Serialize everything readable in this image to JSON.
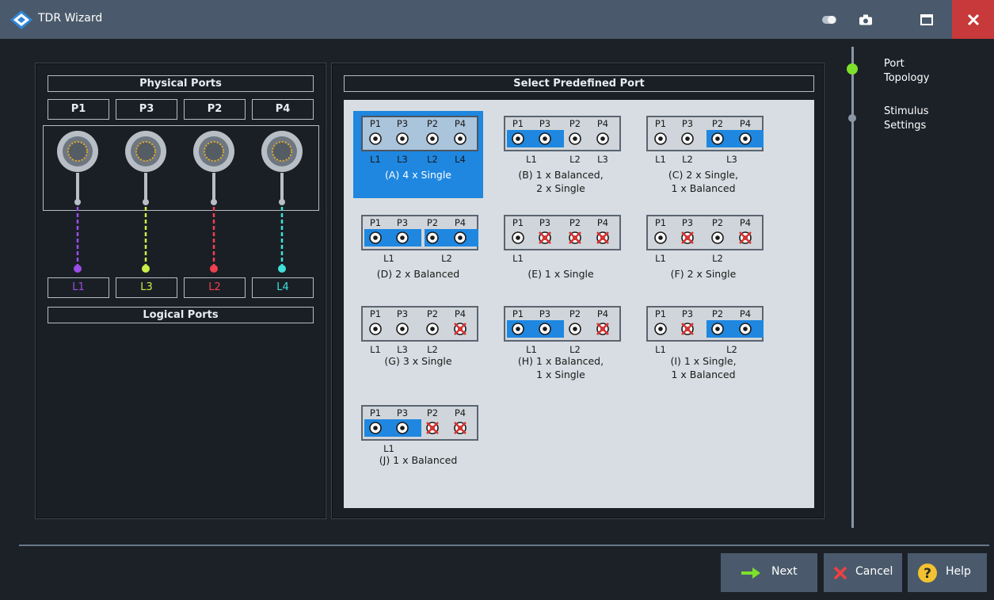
{
  "window": {
    "title": "TDR Wizard"
  },
  "physical_panel": {
    "header": "Physical Ports",
    "footer": "Logical Ports",
    "physical_ports": [
      "P1",
      "P3",
      "P2",
      "P4"
    ],
    "logical_ports": [
      "L1",
      "L3",
      "L2",
      "L4"
    ],
    "line_colors": [
      "#9b4de8",
      "#c8f048",
      "#f0404e",
      "#40e0d8"
    ]
  },
  "select_panel": {
    "header": "Select Predefined Port",
    "options": [
      {
        "id": "A",
        "label_lines": [
          "(A) 4 x Single"
        ],
        "selected": true,
        "ports": [
          "P1",
          "P3",
          "P2",
          "P4"
        ],
        "logical": [
          "L1",
          "L3",
          "L2",
          "L4"
        ]
      },
      {
        "id": "B",
        "label_lines": [
          "(B) 1 x Balanced,",
          "2 x Single"
        ],
        "selected": false,
        "ports": [
          "P1",
          "P3",
          "P2",
          "P4"
        ],
        "logical": [
          "L1",
          "L2",
          "L3"
        ]
      },
      {
        "id": "C",
        "label_lines": [
          "(C) 2 x Single,",
          "1 x Balanced"
        ],
        "selected": false,
        "ports": [
          "P1",
          "P3",
          "P2",
          "P4"
        ],
        "logical": [
          "L1",
          "L2",
          "L3"
        ]
      },
      {
        "id": "D",
        "label_lines": [
          "(D) 2 x Balanced"
        ],
        "selected": false,
        "ports": [
          "P1",
          "P3",
          "P2",
          "P4"
        ],
        "logical": [
          "L1",
          "L2"
        ]
      },
      {
        "id": "E",
        "label_lines": [
          "(E) 1 x Single"
        ],
        "selected": false,
        "ports": [
          "P1",
          "P3",
          "P2",
          "P4"
        ],
        "logical": [
          "L1"
        ]
      },
      {
        "id": "F",
        "label_lines": [
          "(F) 2 x Single"
        ],
        "selected": false,
        "ports": [
          "P1",
          "P3",
          "P2",
          "P4"
        ],
        "logical": [
          "L1",
          "L2"
        ]
      },
      {
        "id": "G",
        "label_lines": [
          "(G) 3 x Single"
        ],
        "selected": false,
        "ports": [
          "P1",
          "P3",
          "P2",
          "P4"
        ],
        "logical": [
          "L1",
          "L3",
          "L2"
        ]
      },
      {
        "id": "H",
        "label_lines": [
          "(H) 1 x Balanced,",
          "1 x Single"
        ],
        "selected": false,
        "ports": [
          "P1",
          "P3",
          "P2",
          "P4"
        ],
        "logical": [
          "L1",
          "L2"
        ]
      },
      {
        "id": "I",
        "label_lines": [
          "(I) 1 x Single,",
          "1 x Balanced"
        ],
        "selected": false,
        "ports": [
          "P1",
          "P3",
          "P2",
          "P4"
        ],
        "logical": [
          "L1",
          "L2"
        ]
      },
      {
        "id": "J",
        "label_lines": [
          "(J) 1 x Balanced"
        ],
        "selected": false,
        "ports": [
          "P1",
          "P3",
          "P2",
          "P4"
        ],
        "logical": [
          "L1"
        ]
      }
    ]
  },
  "steps": [
    {
      "label_lines": [
        "Port",
        "Topology"
      ],
      "active": true
    },
    {
      "label_lines": [
        "Stimulus",
        "Settings"
      ],
      "active": false
    }
  ],
  "buttons": {
    "next": "Next",
    "cancel": "Cancel",
    "help": "Help"
  },
  "colors": {
    "accent": "#1f87e0",
    "titlebar": "#4a5a6c",
    "close": "#c7393a",
    "active_step": "#7ee02a"
  }
}
